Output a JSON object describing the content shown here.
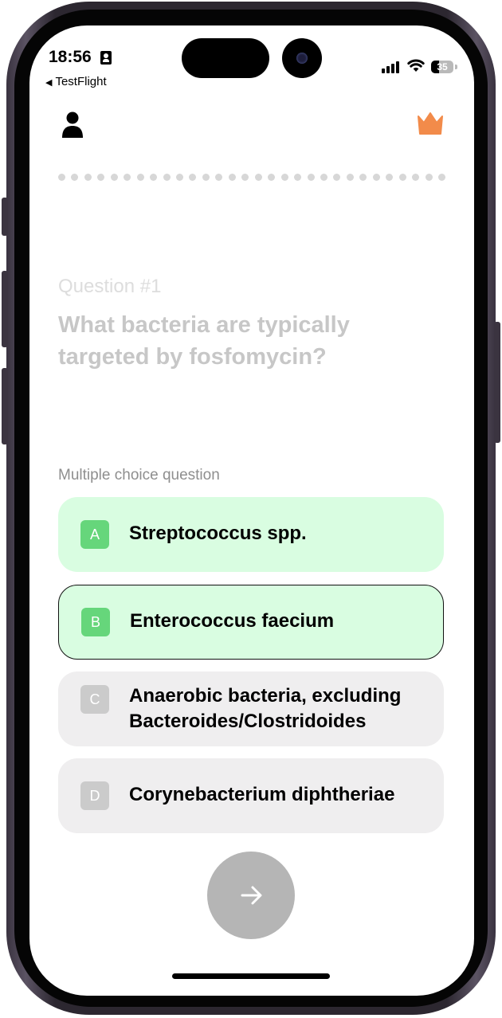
{
  "status_bar": {
    "time": "18:56",
    "back_app": "TestFlight",
    "battery_percent": "35",
    "battery_level": 0.35,
    "signal_bars": 4
  },
  "header": {
    "profile_icon": "person-icon",
    "premium_icon": "crown-icon",
    "accent_color": "#f28b4a"
  },
  "progress": {
    "total_dots": 30,
    "completed": 0
  },
  "question": {
    "number_label": "Question #1",
    "text": "What bacteria are typically targeted by fosfomycin?"
  },
  "answers": {
    "type_label": "Multiple choice question",
    "options": [
      {
        "letter": "A",
        "text": "Streptococcus spp.",
        "state": "highlighted"
      },
      {
        "letter": "B",
        "text": "Enterococcus faecium",
        "state": "selected"
      },
      {
        "letter": "C",
        "text": "Anaerobic bacteria, excluding Bacteroides/Clostridoides",
        "state": "default"
      },
      {
        "letter": "D",
        "text": "Corynebacterium diphtheriae",
        "state": "default"
      }
    ]
  },
  "next_button": {
    "icon": "arrow-right-icon"
  },
  "colors": {
    "option_highlight": "#d9fde1",
    "option_default": "#efeeef",
    "letter_badge_green": "#66d67b",
    "letter_badge_gray": "#cbcbcb"
  }
}
